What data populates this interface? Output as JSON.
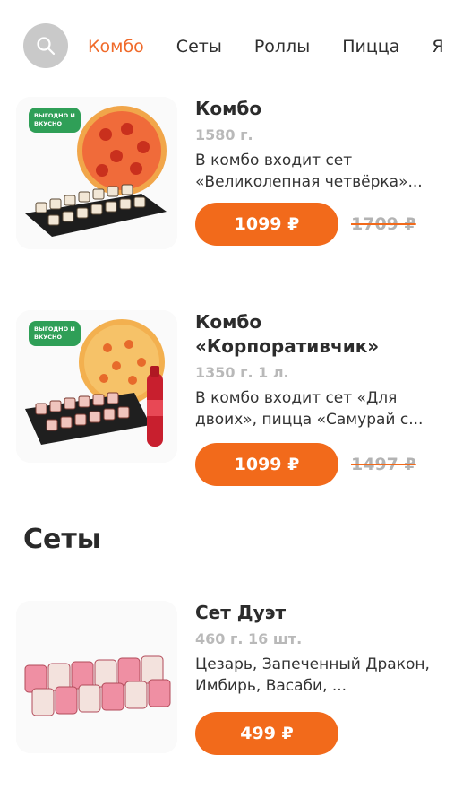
{
  "nav": {
    "tabs": [
      {
        "label": "Комбо",
        "active": true
      },
      {
        "label": "Сеты",
        "active": false
      },
      {
        "label": "Роллы",
        "active": false
      },
      {
        "label": "Пицца",
        "active": false
      },
      {
        "label": "Я",
        "active": false
      }
    ],
    "search_icon": "search-icon"
  },
  "colors": {
    "accent": "#f26a1b",
    "active_tab": "#f06a2a",
    "muted": "#b9b9b9",
    "badge_green": "#2f9f57"
  },
  "products": [
    {
      "title": "Комбо",
      "weight": "1580 г.",
      "description": "В комбо входит сет «Великолепная четвёрка»...",
      "price": "1099 ₽",
      "old_price": "1709 ₽",
      "badge": "выгодно и вкусно"
    },
    {
      "title": "Комбо «Корпоративчик»",
      "weight": "1350 г. 1 л.",
      "description": "В комбо входит сет «Для двоих», пицца «Самурай с...",
      "price": "1099 ₽",
      "old_price": "1497 ₽",
      "badge": "выгодно и вкусно"
    }
  ],
  "sections": {
    "sets_title": "Сеты"
  },
  "set_product": {
    "title": "Сет Дуэт",
    "weight": "460 г. 16 шт.",
    "description": "Цезарь, Запеченный Дракон, Имбирь, Васаби, ...",
    "price": "499 ₽"
  }
}
